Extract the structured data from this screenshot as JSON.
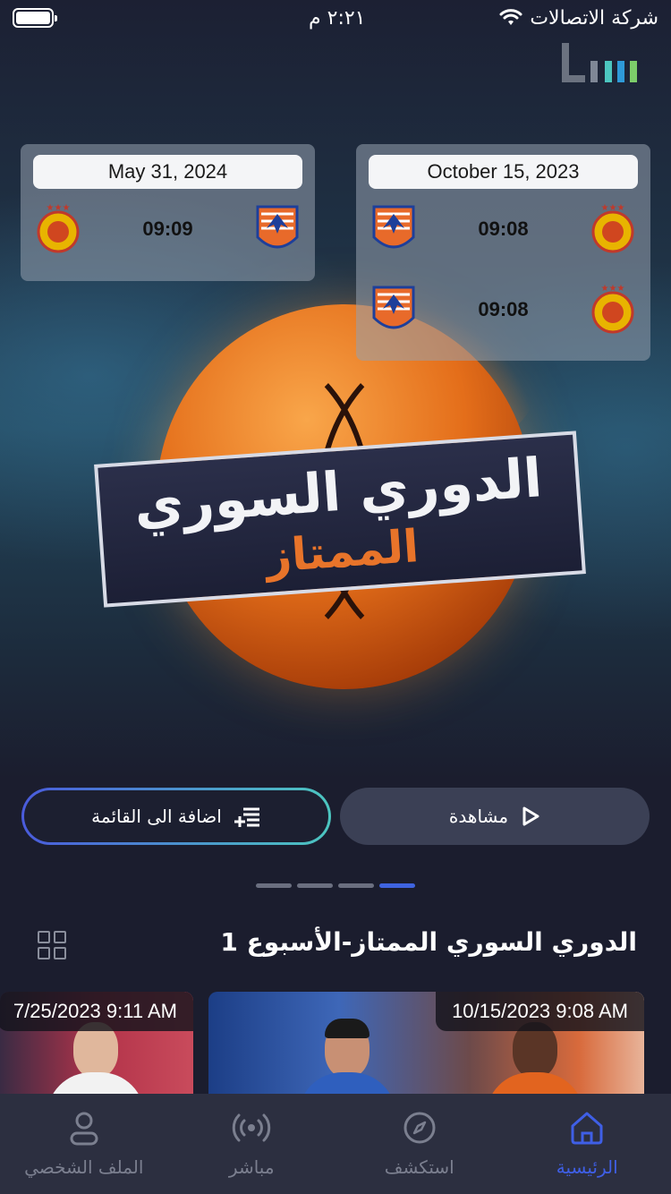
{
  "status_bar": {
    "carrier": "شركة الاتصالات",
    "time": "٢:٢١ م"
  },
  "matches": {
    "left_card": {
      "date": "May 31, 2024",
      "rows": [
        {
          "time": "09:09"
        }
      ]
    },
    "right_card": {
      "date": "October 15, 2023",
      "rows": [
        {
          "time": "09:08"
        },
        {
          "time": "09:08"
        }
      ]
    }
  },
  "hero": {
    "title_line1": "الدوري السوري",
    "title_line2": "الممتاز"
  },
  "actions": {
    "watch_label": "مشاهدة",
    "add_label": "اضافة الى القائمة"
  },
  "pager": {
    "count": 4,
    "active_index": 3
  },
  "section": {
    "title": "الدوري السوري الممتاز-الأسبوع 1"
  },
  "videos": [
    {
      "datetime": "10/15/2023 9:08 AM"
    },
    {
      "datetime": "7/25/2023 9:11 AM"
    }
  ],
  "tabs": [
    {
      "label": "الرئيسية",
      "icon": "home-icon",
      "active": true
    },
    {
      "label": "استكشف",
      "icon": "compass-icon",
      "active": false
    },
    {
      "label": "مباشر",
      "icon": "live-broadcast-icon",
      "active": false
    },
    {
      "label": "الملف الشخصي",
      "icon": "user-icon",
      "active": false
    }
  ],
  "colors": {
    "background": "#1b1d2e",
    "accent_blue": "#3f5fe6",
    "accent_teal": "#4cc6c0",
    "title_orange": "#e8742a",
    "tab_bar": "#2c2f40"
  }
}
